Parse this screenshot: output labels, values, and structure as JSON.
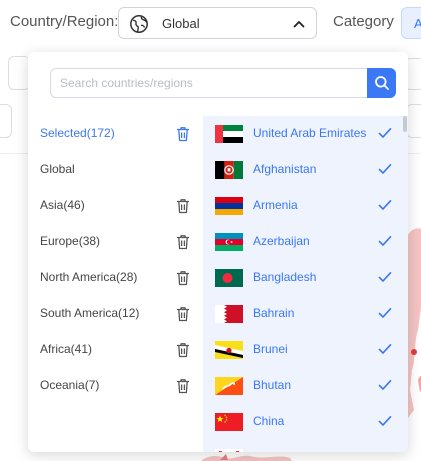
{
  "filters": {
    "country_label": "Country/Region:",
    "region_value": "Global",
    "category_label": "Category",
    "category_chip": "A"
  },
  "search": {
    "placeholder": "Search countries/regions"
  },
  "regions": [
    {
      "label": "Selected(172)",
      "selected": true,
      "trash": true
    },
    {
      "label": "Global",
      "selected": false,
      "trash": false
    },
    {
      "label": "Asia(46)",
      "selected": false,
      "trash": true
    },
    {
      "label": "Europe(38)",
      "selected": false,
      "trash": true
    },
    {
      "label": "North America(28)",
      "selected": false,
      "trash": true
    },
    {
      "label": "South America(12)",
      "selected": false,
      "trash": true
    },
    {
      "label": "Africa(41)",
      "selected": false,
      "trash": true
    },
    {
      "label": "Oceania(7)",
      "selected": false,
      "trash": true
    }
  ],
  "countries": [
    {
      "name": "United Arab Emirates",
      "flag": "uae-flag-icon",
      "checked": true
    },
    {
      "name": "Afghanistan",
      "flag": "afghanistan-flag-icon",
      "checked": true
    },
    {
      "name": "Armenia",
      "flag": "armenia-flag-icon",
      "checked": true
    },
    {
      "name": "Azerbaijan",
      "flag": "azerbaijan-flag-icon",
      "checked": true
    },
    {
      "name": "Bangladesh",
      "flag": "bangladesh-flag-icon",
      "checked": true
    },
    {
      "name": "Bahrain",
      "flag": "bahrain-flag-icon",
      "checked": true
    },
    {
      "name": "Brunei",
      "flag": "brunei-flag-icon",
      "checked": true
    },
    {
      "name": "Bhutan",
      "flag": "bhutan-flag-icon",
      "checked": true
    },
    {
      "name": "China",
      "flag": "china-flag-icon",
      "checked": true
    }
  ],
  "colors": {
    "accent": "#3a78f2",
    "selected_bg": "#eef3fe",
    "text": "#444444"
  }
}
